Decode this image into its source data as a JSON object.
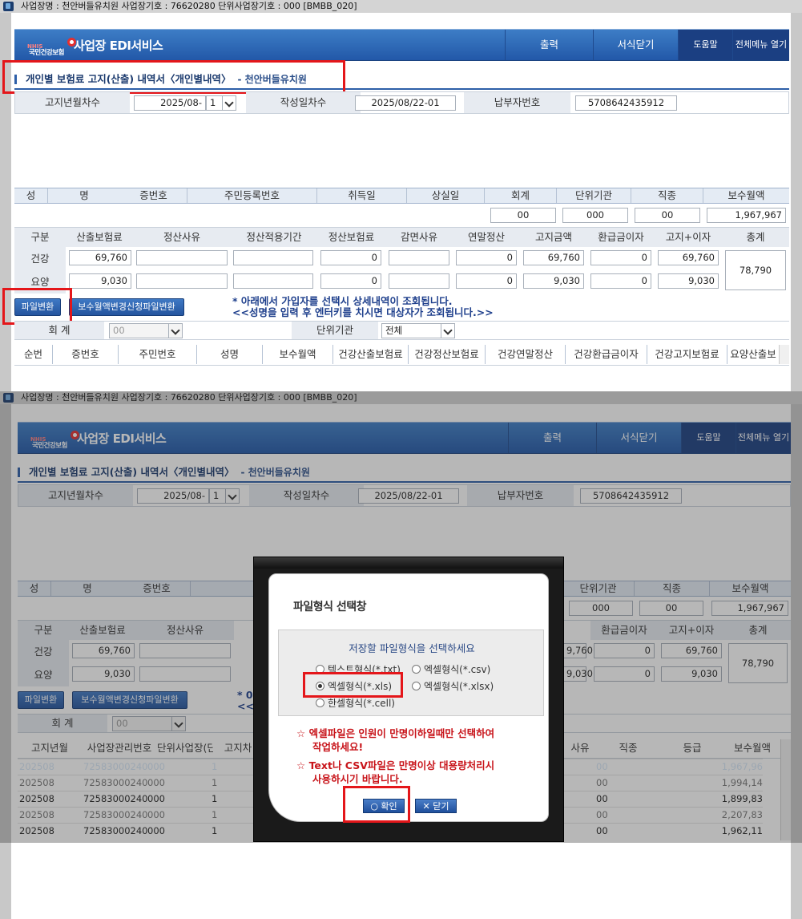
{
  "titlebar": {
    "text": "사업장명 : 천안버들유치원 사업장기호 : 76620280 단위사업장기호 : 000 [BMBB_020]"
  },
  "header": {
    "logo_text": "국민건강보험",
    "logo_small": "NHIS",
    "brand": "사업장 EDI서비스",
    "menu": [
      "출력",
      "서식닫기",
      "도움말",
      "전체메뉴 열기"
    ]
  },
  "section": {
    "title": "개인별 보험료 고지(산출) 내역서〈개인별내역〉",
    "subtitle": "- 천안버들유치원"
  },
  "filters": {
    "notice_month_label": "고지년월차수",
    "notice_month_value": "2025/08-",
    "notice_seq": "1",
    "created_label": "작성일차수",
    "created_value": "2025/08/22-01",
    "payer_label": "납부자번호",
    "payer_value": "5708642435912"
  },
  "person_headers": [
    "성",
    "명",
    "증번호",
    "주민등록번호",
    "취득일",
    "상실일",
    "회계",
    "단위기관",
    "직종",
    "보수월액"
  ],
  "person_values": {
    "account": "00",
    "unit": "000",
    "job": "00",
    "salary": "1,967,967"
  },
  "detail_headers": [
    "구분",
    "산출보험료",
    "정산사유",
    "정산적용기간",
    "정산보험료",
    "감면사유",
    "연말정산",
    "고지금액",
    "환급금이자",
    "고지+이자",
    "총계"
  ],
  "detail_rows": [
    {
      "label": "건강",
      "calc": "69,760",
      "settle": "0",
      "yearend": "0",
      "notice": "69,760",
      "refund": "0",
      "total_int": "69,760"
    },
    {
      "label": "요양",
      "calc": "9,030",
      "settle": "0",
      "yearend": "0",
      "notice": "9,030",
      "refund": "0",
      "total_int": "9,030"
    }
  ],
  "grand_total": "78,790",
  "buttons": {
    "file_convert": "파일변환",
    "salary_change": "보수월액변경신청파일변환"
  },
  "notes": [
    "* 아래에서 가입자를 선택시 상세내역이 조회됩니다.",
    "<<성명을 입력 후 엔터키를 치시면 대상자가 조회됩니다.>>"
  ],
  "filter2": {
    "account_label": "회 계",
    "account_value": "00",
    "unit_label": "단위기관",
    "unit_value": "전체"
  },
  "list_headers": [
    "순번",
    "증번호",
    "주민번호",
    "성명",
    "보수월액",
    "건강산출보험료",
    "건강정산보험료",
    "건강연말정산",
    "건강환급금이자",
    "건강고지보험료",
    "요양산출보"
  ],
  "list2_headers": [
    "고지년월",
    "사업장관리번호",
    "단위사업장(단",
    "고지차",
    "사유",
    "직종",
    "등급",
    "보수월액"
  ],
  "list2_rows": [
    {
      "ym": "202508",
      "id": "72583000240",
      "unit": "000",
      "seq": "1",
      "job": "00",
      "salary": "1,967,96"
    },
    {
      "ym": "202508",
      "id": "72583000240",
      "unit": "000",
      "seq": "1",
      "job": "00",
      "salary": "1,994,14"
    },
    {
      "ym": "202508",
      "id": "72583000240",
      "unit": "000",
      "seq": "1",
      "job": "00",
      "salary": "1,899,83"
    },
    {
      "ym": "202508",
      "id": "72583000240",
      "unit": "000",
      "seq": "1",
      "job": "00",
      "salary": "2,207,83"
    },
    {
      "ym": "202508",
      "id": "72583000240",
      "unit": "000",
      "seq": "1",
      "job": "00",
      "salary": "1,962,11"
    }
  ],
  "bottom_partial": {
    "notice_amt1": "9,760",
    "notice_amt2": "9,030",
    "note1": "* 0",
    "note2": "<<"
  },
  "modal": {
    "title": "파일형식 선택창",
    "prompt": "저장할 파일형식을 선택하세요",
    "options": [
      "텍스트형식(*.txt)",
      "엑셀형식(*.csv)",
      "엑셀형식(*.xls)",
      "엑셀형식(*.xlsx)",
      "한셀형식(*.cell)"
    ],
    "selected": "엑셀형식(*.xls)",
    "warn1a": "엑셀파일은 인원이 만명이하일때만 선택하여",
    "warn1b": "작업하세요!",
    "warn2a": "Text나 CSV파일은 만명이상 대용량처리시",
    "warn2b": "사용하시기 바랍니다.",
    "ok": "확인",
    "close": "닫기"
  },
  "colors": {
    "header": "#2a62b0",
    "highlight": "#e4161a",
    "selected_row": "#3d86d4"
  }
}
